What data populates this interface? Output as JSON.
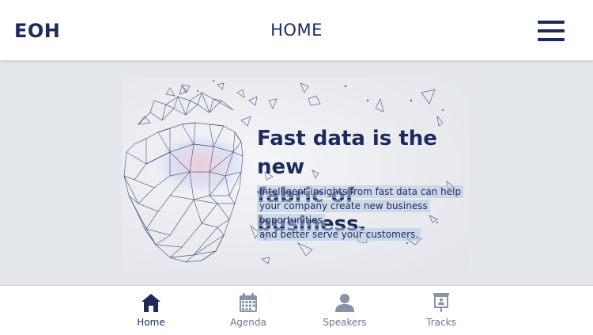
{
  "header": {
    "logo_text": "EOH",
    "title": "HOME",
    "menu_icon": "hamburger-menu-icon"
  },
  "banner": {
    "headline_line1": "Fast data is the new",
    "headline_line2": "fabric of business.",
    "subtext_line1": "Intelligent insights from fast data can help",
    "subtext_line2": "your company create new business opportunities",
    "subtext_line3": "and better serve your customers.",
    "image": "polygon-network-head-illustration"
  },
  "bottom_nav": {
    "items": [
      {
        "label": "Home",
        "icon": "home-icon",
        "active": true
      },
      {
        "label": "Agenda",
        "icon": "calendar-icon",
        "active": false
      },
      {
        "label": "Speakers",
        "icon": "person-icon",
        "active": false
      },
      {
        "label": "Tracks",
        "icon": "presentation-board-icon",
        "active": false
      }
    ]
  },
  "colors": {
    "primary": "#1e2a5c",
    "inactive": "#8a92a8",
    "background": "#e4e7ec",
    "accent_red": "#d8283c"
  }
}
